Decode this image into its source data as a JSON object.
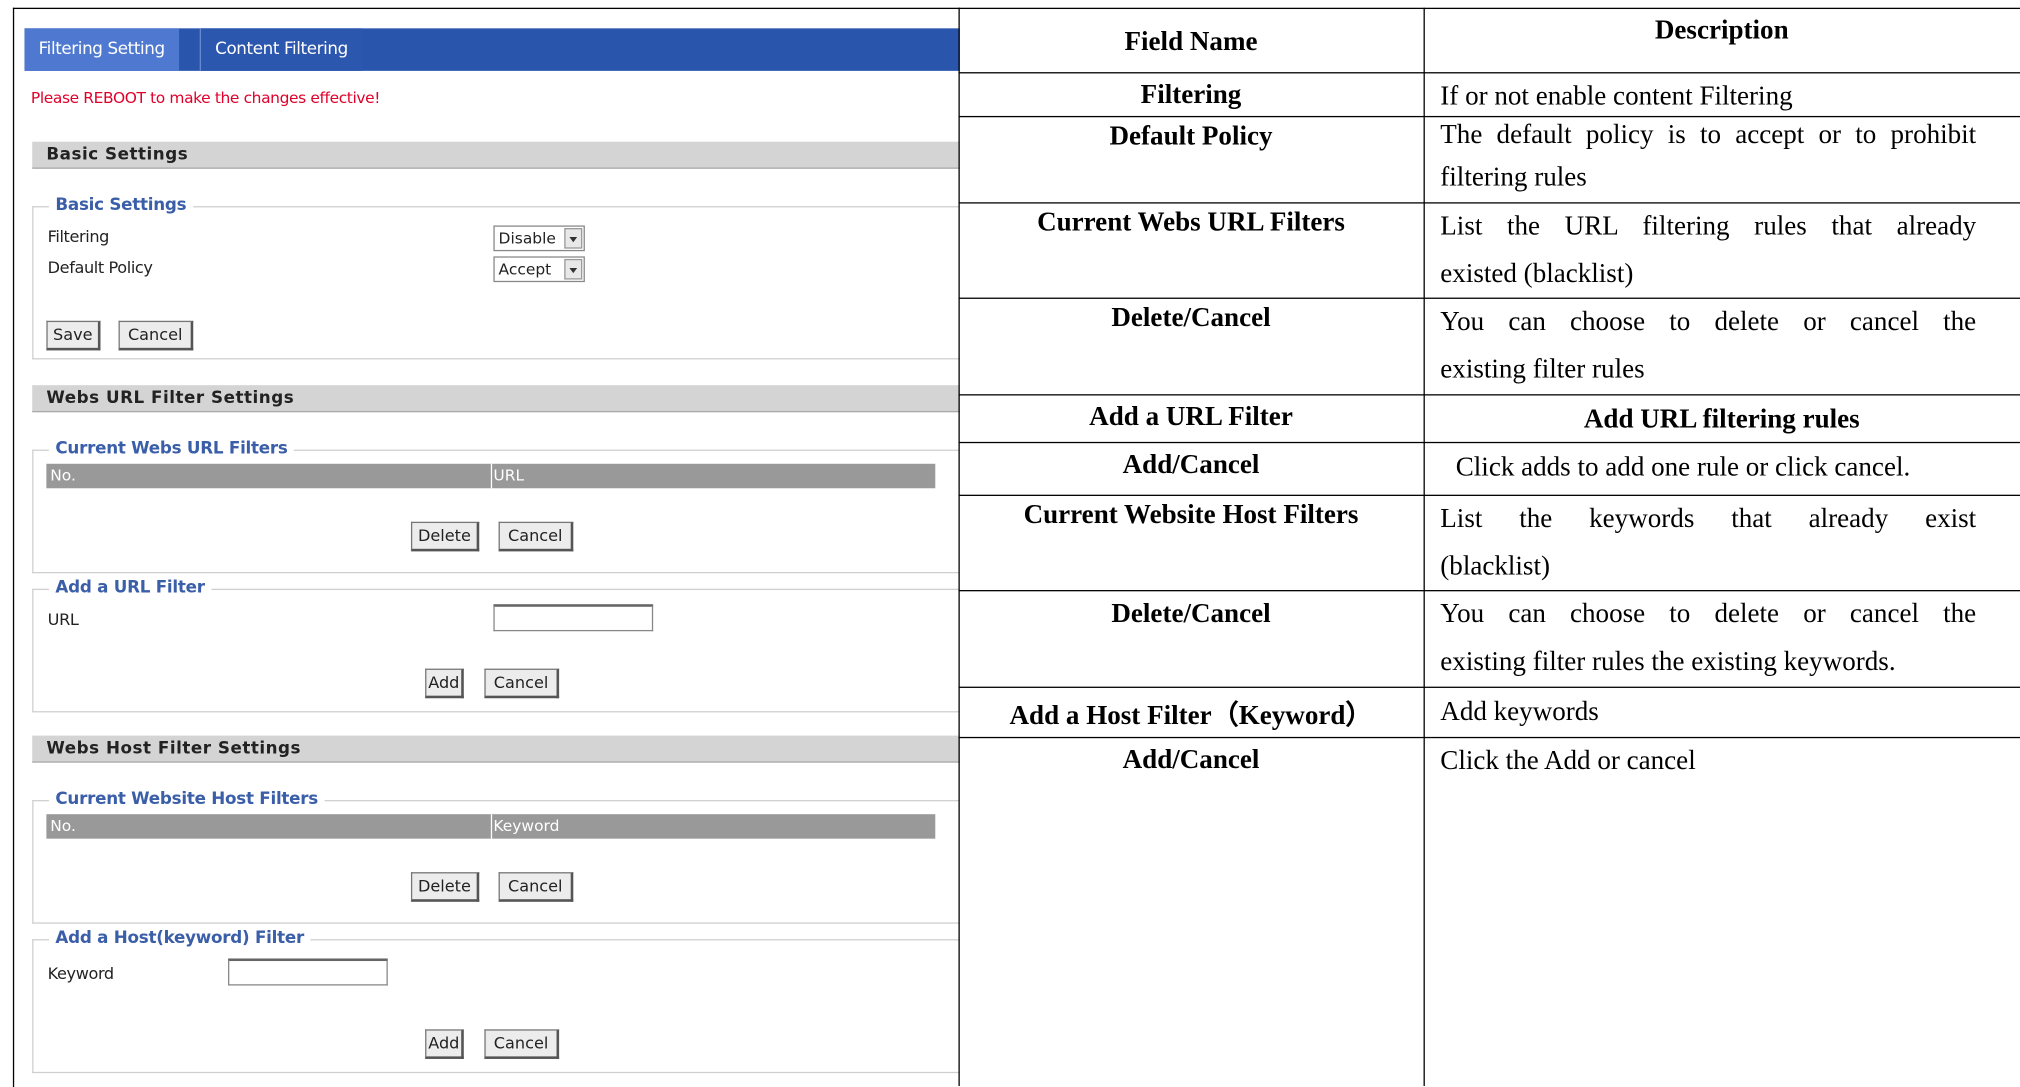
{
  "ui": {
    "tabs": [
      "Filtering Setting",
      "Content Filtering"
    ],
    "notice": "Please REBOOT to make the changes effective!",
    "basic": {
      "section_title": "Basic Settings",
      "legend": "Basic Settings",
      "filtering_label": "Filtering",
      "filtering_value": "Disable",
      "policy_label": "Default Policy",
      "policy_value": "Accept",
      "save": "Save",
      "cancel": "Cancel"
    },
    "url": {
      "section_title": "Webs URL Filter Settings",
      "current_legend": "Current Webs URL Filters",
      "col_no": "No.",
      "col_url": "URL",
      "delete": "Delete",
      "cancel": "Cancel",
      "add_legend": "Add a URL Filter",
      "url_label": "URL",
      "add": "Add",
      "add_cancel": "Cancel"
    },
    "host": {
      "section_title": "Webs Host Filter Settings",
      "current_legend": "Current Website Host Filters",
      "col_no": "No.",
      "col_keyword": "Keyword",
      "delete": "Delete",
      "cancel": "Cancel",
      "add_legend": "Add a Host(keyword) Filter",
      "keyword_label": "Keyword",
      "add": "Add",
      "add_cancel": "Cancel"
    }
  },
  "table": {
    "headers": [
      "Field Name",
      "Description"
    ],
    "rows": [
      {
        "field": "Filtering",
        "desc": [
          "If or not enable content Filtering"
        ]
      },
      {
        "field": "Default Policy",
        "desc": [
          "The default policy is to accept or to prohibit",
          "filtering rules"
        ]
      },
      {
        "field": "Current Webs URL Filters",
        "desc": [
          "List the URL filtering rules that already",
          "existed (blacklist)"
        ]
      },
      {
        "field": "Delete/Cancel",
        "desc": [
          "You can choose to delete or cancel the",
          "existing filter rules"
        ]
      },
      {
        "field": "Add a URL Filter",
        "desc": [
          "Add URL filtering rules"
        ]
      },
      {
        "field": "Add/Cancel",
        "desc": [
          "Click adds to add one rule or click cancel."
        ]
      },
      {
        "field": "Current Website Host Filters",
        "desc": [
          "List the keywords that already exist",
          "(blacklist)"
        ]
      },
      {
        "field": "Delete/Cancel",
        "desc": [
          "You can choose to delete or cancel the",
          "existing filter rules the existing keywords."
        ]
      },
      {
        "field": "Add a Host Filter（Keyword）",
        "desc": [
          "Add keywords"
        ]
      },
      {
        "field": "Add/Cancel",
        "desc": [
          "Click the Add or cancel"
        ]
      }
    ]
  }
}
